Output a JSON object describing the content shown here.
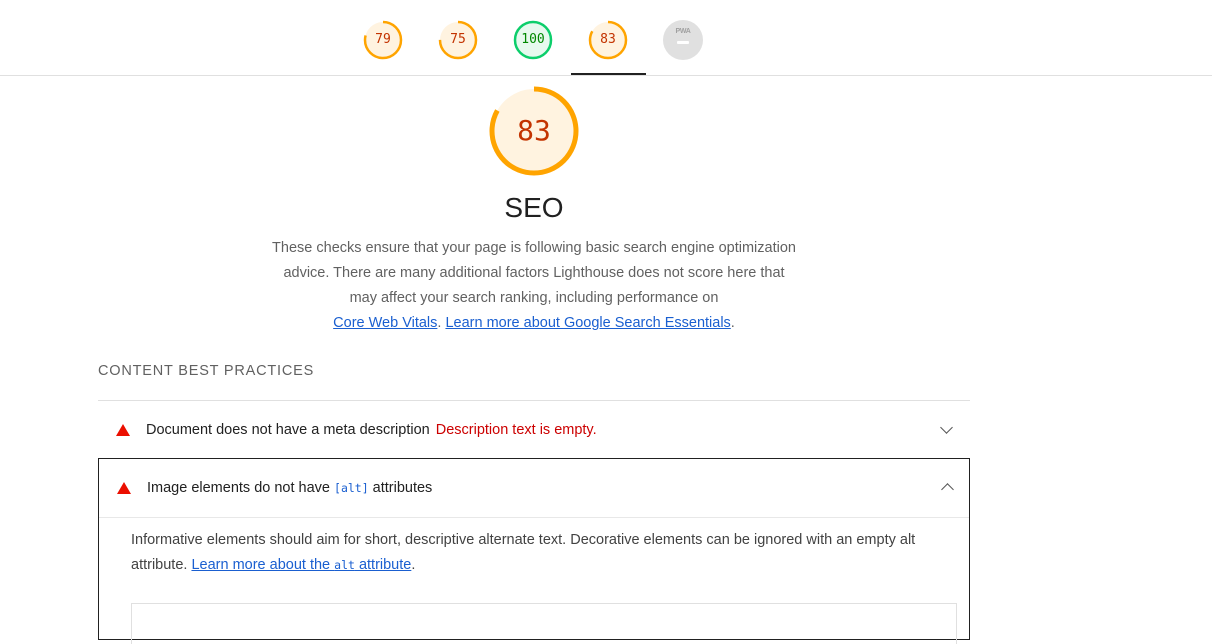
{
  "top_scores": [
    {
      "label": "79",
      "score": 79,
      "color": "#ffa400"
    },
    {
      "label": "75",
      "score": 75,
      "color": "#ffa400"
    },
    {
      "label": "100",
      "score": 100,
      "color": "#0cce6b"
    },
    {
      "label": "83",
      "score": 83,
      "color": "#ffa400"
    },
    {
      "label": "PWA",
      "score": null,
      "color": "#e0e0e0"
    }
  ],
  "category": {
    "score": "83",
    "score_value": 83,
    "title": "SEO",
    "description": "These checks ensure that your page is following basic search engine optimization advice. There are many additional factors Lighthouse does not score here that may affect your search ranking, including performance on",
    "link1": "Core Web Vitals",
    "sep": ". ",
    "link2": "Learn more about Google Search Essentials",
    "end": "."
  },
  "group": {
    "title": "CONTENT BEST PRACTICES"
  },
  "audits": [
    {
      "title": "Document does not have a meta description",
      "display_value": "Description text is empty."
    },
    {
      "title_before": "Image elements do not have ",
      "title_code": "[alt]",
      "title_after": " attributes",
      "description": "Informative elements should aim for short, descriptive alternate text. Decorative elements can be ignored with an empty alt attribute. ",
      "link_before": "Learn more about the ",
      "link_code": "alt",
      "link_after": " attribute",
      "end": "."
    }
  ],
  "colors": {
    "average": "#ffa400",
    "pass": "#0cce6b",
    "fail": "#eb0f00",
    "link": "#1a5fd0"
  }
}
